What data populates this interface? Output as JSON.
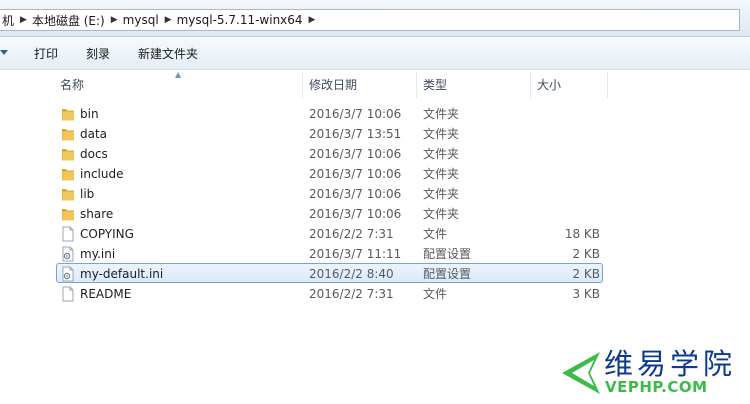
{
  "address_bar": {
    "crumbs": [
      "机",
      "本地磁盘 (E:)",
      "mysql",
      "mysql-5.7.11-winx64"
    ]
  },
  "toolbar": {
    "print_label": "打印",
    "burn_label": "刻录",
    "new_folder_label": "新建文件夹"
  },
  "columns": {
    "name": "名称",
    "date": "修改日期",
    "type": "类型",
    "size": "大小"
  },
  "files": [
    {
      "name": "bin",
      "date": "2016/3/7 10:06",
      "type": "文件夹",
      "size": "",
      "icon": "folder-icon"
    },
    {
      "name": "data",
      "date": "2016/3/7 13:51",
      "type": "文件夹",
      "size": "",
      "icon": "folder-icon"
    },
    {
      "name": "docs",
      "date": "2016/3/7 10:06",
      "type": "文件夹",
      "size": "",
      "icon": "folder-icon"
    },
    {
      "name": "include",
      "date": "2016/3/7 10:06",
      "type": "文件夹",
      "size": "",
      "icon": "folder-icon"
    },
    {
      "name": "lib",
      "date": "2016/3/7 10:06",
      "type": "文件夹",
      "size": "",
      "icon": "folder-icon"
    },
    {
      "name": "share",
      "date": "2016/3/7 10:06",
      "type": "文件夹",
      "size": "",
      "icon": "folder-icon"
    },
    {
      "name": "COPYING",
      "date": "2016/2/2 7:31",
      "type": "文件",
      "size": "18 KB",
      "icon": "file-icon"
    },
    {
      "name": "my.ini",
      "date": "2016/3/7 11:11",
      "type": "配置设置",
      "size": "2 KB",
      "icon": "settings-file-icon"
    },
    {
      "name": "my-default.ini",
      "date": "2016/2/2 8:40",
      "type": "配置设置",
      "size": "2 KB",
      "icon": "settings-file-icon",
      "selected": true
    },
    {
      "name": "README",
      "date": "2016/2/2 7:31",
      "type": "文件",
      "size": "3 KB",
      "icon": "file-icon"
    }
  ],
  "watermark": {
    "title": "维易学院",
    "subtitle": "VEPHP.COM"
  },
  "colors": {
    "folder": "#e8b93b",
    "selection_border": "#7da2ce",
    "logo_blue": "#0d3a8f",
    "logo_green": "#3dbb4a"
  }
}
